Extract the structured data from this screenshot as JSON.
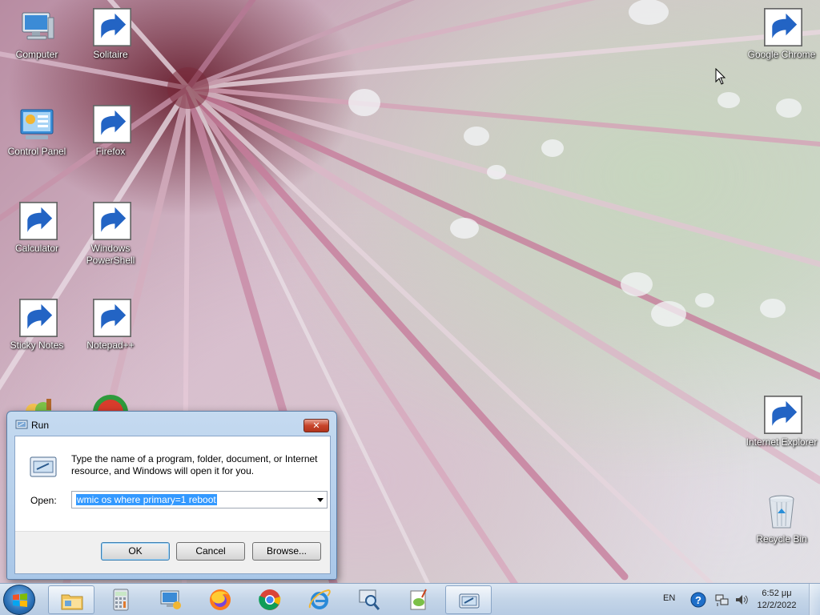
{
  "desktop": {
    "icons": [
      {
        "id": "computer",
        "label": "Computer",
        "icon": "computer-icon"
      },
      {
        "id": "solitaire",
        "label": "Solitaire",
        "icon": "solitaire-icon"
      },
      {
        "id": "control-panel",
        "label": "Control Panel",
        "icon": "control-panel-icon"
      },
      {
        "id": "firefox",
        "label": "Firefox",
        "icon": "firefox-icon"
      },
      {
        "id": "calculator",
        "label": "Calculator",
        "icon": "calculator-icon"
      },
      {
        "id": "powershell",
        "label": "Windows PowerShell",
        "icon": "powershell-icon"
      },
      {
        "id": "sticky-notes",
        "label": "Sticky Notes",
        "icon": "sticky-notes-icon"
      },
      {
        "id": "notepadpp",
        "label": "Notepad++",
        "icon": "notepadpp-icon"
      },
      {
        "id": "google-chrome",
        "label": "Google Chrome",
        "icon": "chrome-icon"
      },
      {
        "id": "internet-explorer",
        "label": "Internet Explorer",
        "icon": "ie-icon"
      },
      {
        "id": "recycle-bin",
        "label": "Recycle Bin",
        "icon": "recycle-bin-icon"
      }
    ]
  },
  "run_dialog": {
    "title": "Run",
    "close_label": "✕",
    "message": "Type the name of a program, folder, document, or Internet resource, and Windows will open it for you.",
    "open_label": "Open:",
    "command_value": "wmic os where primary=1 reboot",
    "ok_label": "OK",
    "cancel_label": "Cancel",
    "browse_label": "Browse..."
  },
  "taskbar": {
    "items": [
      "explorer-icon",
      "calculator-icon",
      "remote-desktop-icon",
      "firefox-icon",
      "chrome-icon",
      "ie-icon",
      "search-icon",
      "notepadpp-icon",
      "run-icon"
    ],
    "active_item": "explorer-icon",
    "language": "EN",
    "clock_time": "6:52 μμ",
    "clock_date": "12/2/2022"
  },
  "colors": {
    "taskbar": "#c4d5e8",
    "selection": "#3399ff",
    "close_button": "#c7452b"
  }
}
